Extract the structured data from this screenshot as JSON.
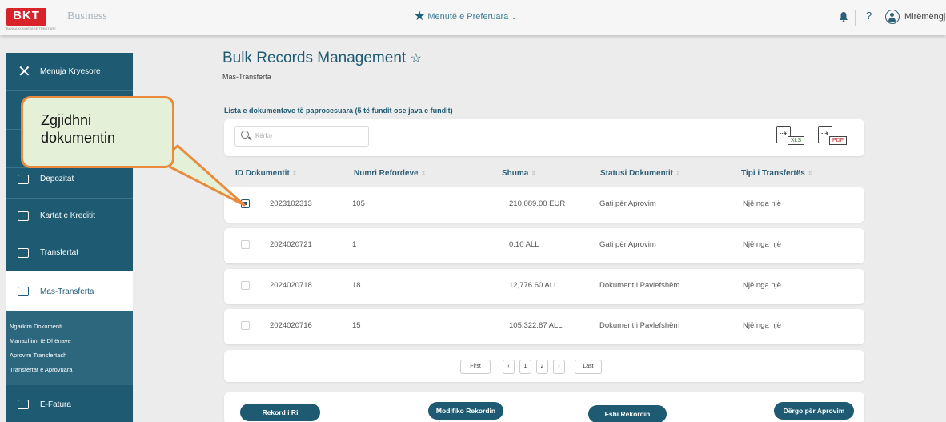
{
  "topbar": {
    "logo": "BKT",
    "logo_sub": "BANKA KOMBËTARE TREGTARE",
    "brand": "Business",
    "favorites": "Menutë e Preferuara",
    "help": "?",
    "greeting": "Mirëmëngje"
  },
  "sidebar": {
    "close_label": "Menuja Kryesore",
    "items": [
      {
        "label": "Depozitat",
        "icon": "deposit-icon"
      },
      {
        "label": "Kartat e Kreditit",
        "icon": "credit-card-icon"
      },
      {
        "label": "Transfertat",
        "icon": "transfer-icon"
      },
      {
        "label": "Mas-Transferta",
        "icon": "bulk-transfer-icon",
        "active": true
      },
      {
        "label": "E-Fatura",
        "icon": "invoice-icon"
      }
    ],
    "submenu": [
      "Ngarkim Dokumenti",
      "Manaxhimi të Dhënave",
      "Aprovim Transfertash",
      "Transfertat e Aprovuara"
    ]
  },
  "page": {
    "title": "Bulk Records Management",
    "subtitle": "Mas-Transferta",
    "list_heading": "Lista e dokumentave të paprocesuara (5 të fundit ose java e fundit)",
    "search_placeholder": "Kërko",
    "export_xls": "XLS",
    "export_pdf": "PDF"
  },
  "table": {
    "columns": [
      "ID Dokumentit",
      "Numri Refordeve",
      "Shuma",
      "Statusi Dokumentit",
      "Tipi i Transfertës"
    ],
    "rows": [
      {
        "id": "2023102313",
        "count": "105",
        "amount": "210,089.00 EUR",
        "status": "Gati për Aprovim",
        "type": "Një nga një",
        "checked": true
      },
      {
        "id": "2024020721",
        "count": "1",
        "amount": "0.10 ALL",
        "status": "Gati për Aprovim",
        "type": "Një nga një",
        "checked": false
      },
      {
        "id": "2024020718",
        "count": "18",
        "amount": "12,776.60 ALL",
        "status": "Dokument i Pavlefshëm",
        "type": "Një nga një",
        "checked": false
      },
      {
        "id": "2024020716",
        "count": "15",
        "amount": "105,322.67 ALL",
        "status": "Dokument i Pavlefshëm",
        "type": "Një nga një",
        "checked": false
      }
    ]
  },
  "pager": {
    "first": "First",
    "prev": "‹",
    "p1": "1",
    "p2": "2",
    "next": "›",
    "last": "Last"
  },
  "actions": {
    "new": "Rekord i Ri",
    "edit": "Modifiko Rekordin",
    "delete": "Fshi Rekordin",
    "send": "Dërgo për Aprovim"
  },
  "callout": {
    "line1": "Zgjidhni",
    "line2": "dokumentin"
  },
  "colors": {
    "primary": "#1e5a72",
    "callout_border": "#e98a3c",
    "callout_fill": "#e4f0d8"
  }
}
